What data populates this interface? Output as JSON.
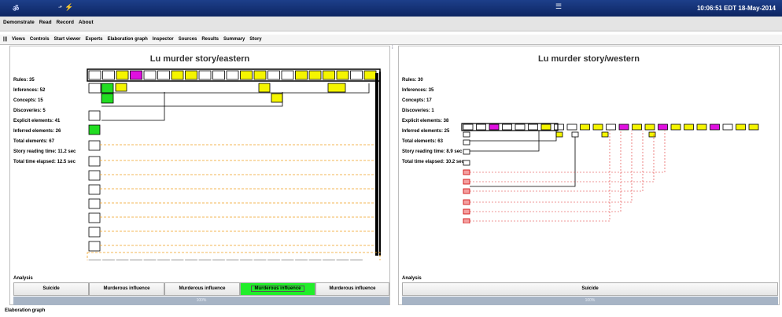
{
  "window": {
    "clock": "10:06:51 EDT 18-May-2014",
    "logo": "ॐ",
    "icons": [
      "⬏",
      "⚡",
      "☰"
    ]
  },
  "menu": {
    "items": [
      "Demonstrate",
      "Read",
      "Record",
      "About"
    ]
  },
  "toolbar": {
    "handle": "|||",
    "items": [
      "Views",
      "Controls",
      "Start viewer",
      "Experts",
      "Elaboration graph",
      "Inspector",
      "Sources",
      "Results",
      "Summary",
      "Story"
    ]
  },
  "left": {
    "title": "Lu murder story/eastern",
    "stats": [
      "Rules: 35",
      "Inferences: 52",
      "Concepts: 15",
      "Discoveries: 5",
      "Explicit elements: 41",
      "Inferred elements: 26",
      "Total elements: 67",
      "Story reading time: 11.2 sec",
      "Total time elapsed: 12.5 sec"
    ],
    "analysis_label": "Analysis",
    "buttons": [
      "Suicide",
      "Murderous influence",
      "Murderous influence",
      "Murderous influence",
      "Murderous influence"
    ],
    "selected_index": 3,
    "progress_label": "100%",
    "progress": 1.0
  },
  "right": {
    "title": "Lu murder story/western",
    "stats": [
      "Rules: 30",
      "Inferences: 35",
      "Concepts: 17",
      "Discoveries: 1",
      "Explicit elements: 38",
      "Inferred elements: 25",
      "Total elements: 63",
      "Story reading time: 8.9 sec",
      "Total time elapsed: 10.2 sec"
    ],
    "analysis_label": "Analysis",
    "buttons": [
      "Suicide"
    ],
    "progress_label": "100%",
    "progress": 1.0
  },
  "statusbar": "Elaboration graph",
  "colors": {
    "title_bg": "#13306f",
    "node_yellow": "#f5f500",
    "node_orange": "#f0a020",
    "node_magenta": "#e010e0",
    "node_green": "#22dd22",
    "node_pink": "#f4a0a0",
    "selected_green": "#21ee2a",
    "progress": "#a7b4c5"
  }
}
